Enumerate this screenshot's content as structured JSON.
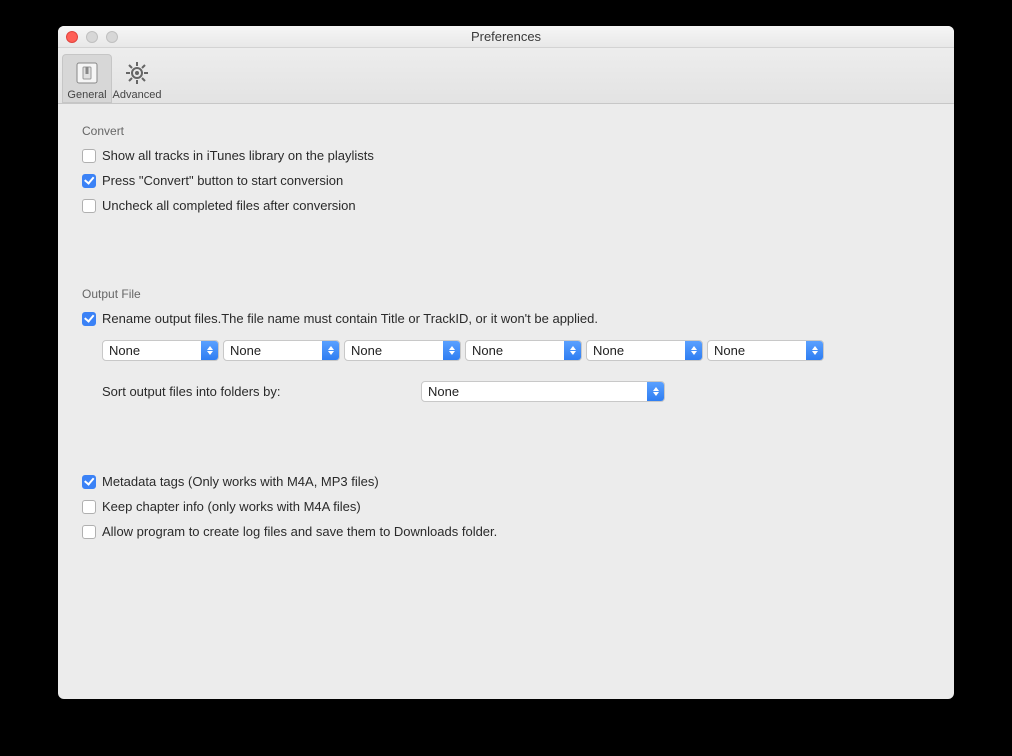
{
  "window": {
    "title": "Preferences"
  },
  "toolbar": {
    "general": "General",
    "advanced": "Advanced"
  },
  "sections": {
    "convert": {
      "header": "Convert",
      "show_all": {
        "label": "Show all tracks in iTunes library on the playlists",
        "checked": false
      },
      "press_convert": {
        "label": "Press \"Convert\" button to start conversion",
        "checked": true
      },
      "uncheck_completed": {
        "label": "Uncheck all completed files after conversion",
        "checked": false
      }
    },
    "output": {
      "header": "Output File",
      "rename": {
        "label": "Rename output files.The file name must contain Title or TrackID, or it won't be applied.",
        "checked": true
      },
      "rename_fields": [
        "None",
        "None",
        "None",
        "None",
        "None",
        "None"
      ],
      "sort_label": "Sort output files into folders by:",
      "sort_value": "None",
      "metadata": {
        "label": "Metadata tags (Only works with M4A, MP3 files)",
        "checked": true
      },
      "chapter": {
        "label": "Keep chapter info (only works with  M4A files)",
        "checked": false
      },
      "log": {
        "label": "Allow program to create log files and save them to Downloads folder.",
        "checked": false
      }
    }
  }
}
